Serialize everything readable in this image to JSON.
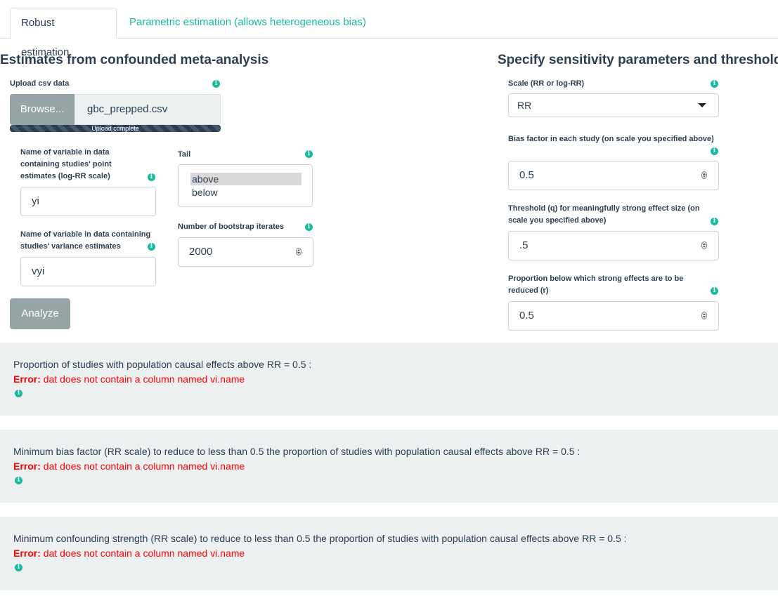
{
  "tabs": [
    {
      "label": "Robust estimation",
      "active": true
    },
    {
      "label": "Parametric estimation (allows heterogeneous bias)",
      "active": false
    }
  ],
  "left": {
    "title": "Estimates from confounded meta-analysis",
    "upload": {
      "label": "Upload csv data",
      "browse_label": "Browse...",
      "filename": "gbc_prepped.csv",
      "progress_text": "Upload complete",
      "progress": 1.0
    },
    "yi": {
      "label": "Name of variable in data containing studies' point estimates (log-RR scale)",
      "value": "yi"
    },
    "vi": {
      "label": "Name of variable in data containing studies' variance estimates",
      "value": "vyi"
    },
    "tail": {
      "label": "Tail",
      "options": [
        "above",
        "below"
      ],
      "selected": "above"
    },
    "boot": {
      "label": "Number of bootstrap iterates",
      "value": "2000"
    },
    "analyze_label": "Analyze"
  },
  "right": {
    "title": "Specify sensitivity parameters and thresholds",
    "scale": {
      "label": "Scale (RR or log-RR)",
      "value": "RR"
    },
    "bias": {
      "label": "Bias factor in each study (on scale you specified above)",
      "value": "0.5"
    },
    "q": {
      "label": "Threshold (q) for meaningfully strong effect size (on scale you specified above)",
      "value": ".5"
    },
    "r": {
      "label": "Proportion below which strong effects are to be reduced (r)",
      "value": "0.5"
    }
  },
  "results": [
    {
      "text": "Proportion of studies with population causal effects above RR = 0.5 :",
      "error_prefix": "Error:",
      "error_text": " dat does not contain a column named vi.name"
    },
    {
      "text": "Minimum bias factor (RR scale) to reduce to less than 0.5 the proportion of studies with population causal effects above RR = 0.5 :",
      "error_prefix": "Error:",
      "error_text": " dat does not contain a column named vi.name"
    },
    {
      "text": "Minimum confounding strength (RR scale) to reduce to less than 0.5 the proportion of studies with population causal effects above RR = 0.5 :",
      "error_prefix": "Error:",
      "error_text": " dat does not contain a column named vi.name"
    }
  ],
  "info_icon_glyph": "i",
  "colors": {
    "accent": "#18bc9c",
    "error": "#ff0000",
    "primary": "#2c3e50",
    "button": "#95a5a6",
    "panel": "#ecf0f1"
  }
}
